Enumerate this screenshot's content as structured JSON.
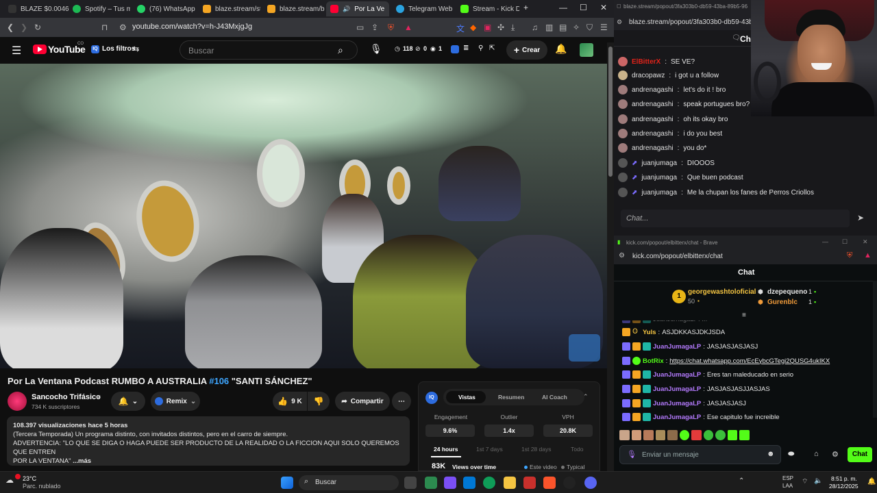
{
  "tabs": [
    {
      "label": "BLAZE $0.004610",
      "color": "#111"
    },
    {
      "label": "Spotify – Tus me",
      "color": "#1db954"
    },
    {
      "label": "(76) WhatsApp",
      "color": "#25d366"
    },
    {
      "label": "blaze.stream/stre",
      "color": "#f5a623"
    },
    {
      "label": "blaze.stream/bac",
      "color": "#f5a623"
    },
    {
      "label": "Por La Ve",
      "color": "#ff0033"
    },
    {
      "label": "Telegram Web",
      "color": "#2aa3e0"
    },
    {
      "label": "Stream - Kick Da",
      "color": "#53fc18"
    }
  ],
  "browser": {
    "url": "youtube.com/watch?v=h-J43MxjgJg",
    "new_tab_label": "+"
  },
  "youtube": {
    "logo": "YouTube",
    "logo_suffix": "CO",
    "filters_label": "Los filtros",
    "search_placeholder": "Buscar",
    "stats_1": "118",
    "stats_2": "0",
    "stats_3": "1",
    "create_label": "Crear",
    "video_title_main": "Por La Ventana Podcast RUMBO A AUSTRALIA ",
    "video_title_tag": "#106",
    "video_title_end": " \"SANTI SÁNCHEZ\"",
    "channel_name": "Sancocho Trifásico",
    "subscribers": "734 K suscriptores",
    "remix_label": "Remix",
    "likes": "9 K",
    "share_label": "Compartir",
    "desc_line1": "108.397 visualizaciones  hace 5 horas",
    "desc_line2": "(Tercera Temporada) Un programa distinto, con invitados distintos, pero en el carro de siempre.",
    "desc_line3": "ADVERTENCIA: \"LO QUE SE DIGA O HAGA PUEDE SER PRODUCTO DE LA REALIDAD O LA FICCION AQUI SOLO QUEREMOS QUE ENTREN",
    "desc_line4": "POR LA VENTANA\"",
    "desc_more": "...más"
  },
  "iq_panel": {
    "badge": "IQ",
    "tabs": [
      "Vistas",
      "Resumen",
      "AI Coach"
    ],
    "metrics": [
      {
        "label": "Engagement",
        "value": "9.6%"
      },
      {
        "label": "Outlier",
        "value": "1.4x"
      },
      {
        "label": "VPH",
        "value": "20.8K"
      }
    ],
    "ranges": [
      "24 hours",
      "1st 7 days",
      "1st 28 days",
      "Todo"
    ],
    "views_value": "83K",
    "views_label": "Views over time",
    "legend_this": "Este video",
    "legend_typical": "Typical"
  },
  "blaze_chat": {
    "url": "blaze.stream/popout/3fa303b0-db59-43ba-89b5-96",
    "url2": "blaze.stream/popout/3fa303b0-db59-43ba",
    "header": "Chat",
    "messages": [
      {
        "user": "ElBitterX",
        "text": "SE VE?"
      },
      {
        "user": "dracopawz",
        "text": "i got u a follow"
      },
      {
        "user": "andrenagashi",
        "text": "let's do it ! bro"
      },
      {
        "user": "andrenagashi",
        "text": "speak portugues bro?"
      },
      {
        "user": "andrenagashi",
        "text": "oh its okay bro"
      },
      {
        "user": "andrenagashi",
        "text": "i do you best"
      },
      {
        "user": "andrenagashi",
        "text": "you do*"
      },
      {
        "user": "juanjumaga",
        "text": "DIOOOS"
      },
      {
        "user": "juanjumaga",
        "text": "Que buen podcast"
      },
      {
        "user": "juanjumaga",
        "text": "Me la chupan los fanes de Perros Criollos"
      }
    ],
    "input_placeholder": "Chat..."
  },
  "kick": {
    "window_title": "kick.com/popout/elbitterx/chat - Brave",
    "url": "kick.com/popout/elbitterx/chat",
    "header": "Chat",
    "top_gifter": "georgewashtoloficial",
    "top_gifter_count": "50",
    "rank_badge": "1",
    "gifter2": "dzepequeno",
    "gifter2_count": "1",
    "gifter3": "Gurenblc",
    "gifter3_count": "1",
    "partial_line": "JuanJumagaLP: ...",
    "messages": [
      {
        "user": "Yuls",
        "text": "ASJDKKASJDKJSDA",
        "color": "#f5c542"
      },
      {
        "user": "JuanJumagaLP",
        "text": "JASJASJASJASJ",
        "color": "#b57bff"
      },
      {
        "user": "BotRix",
        "text": "https://chat.whatsapp.com/EcEybcGTegi2QUSG4ukIKX",
        "color": "#53fc18"
      },
      {
        "user": "JuanJumagaLP",
        "text": "Eres tan maleducado en serio",
        "color": "#b57bff"
      },
      {
        "user": "JuanJumagaLP",
        "text": "JASJASJASJJASJAS",
        "color": "#b57bff"
      },
      {
        "user": "JuanJumagaLP",
        "text": "JASJASJASJ",
        "color": "#b57bff"
      },
      {
        "user": "JuanJumagaLP",
        "text": "Ese capitulo fue increible",
        "color": "#b57bff"
      }
    ],
    "input_placeholder": "Enviar un mensaje",
    "chat_button": "Chat"
  },
  "taskbar": {
    "weather_temp": "23°C",
    "weather_desc": "Parc. nublado",
    "search_label": "Buscar",
    "lang1": "ESP",
    "lang2": "LAA",
    "time": "8:51 p. m.",
    "date": "28/12/2025"
  }
}
